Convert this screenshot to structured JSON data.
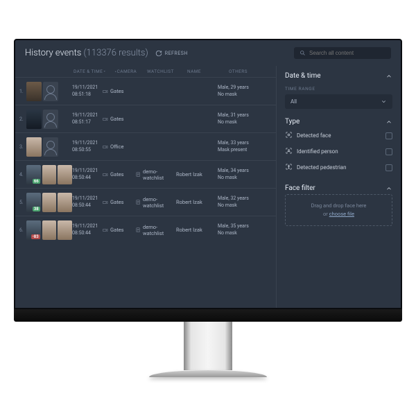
{
  "header": {
    "title": "History events",
    "result_count": "(113376 results)",
    "refresh": "REFRESH",
    "search_placeholder": "Search all content"
  },
  "columns": {
    "datetime": "DATE & TIME",
    "camera": "CAMERA",
    "watchlist": "WATCHLIST",
    "name": "NAME",
    "others": "OTHERS"
  },
  "rows": [
    {
      "idx": "1.",
      "date": "19/11/2021",
      "time": "08:51:18",
      "camera": "Gates",
      "watchlist": "",
      "name": "",
      "other1": "Male, 29 years",
      "other2": "No mask",
      "thumbs": [
        "face1",
        "placeholder"
      ],
      "score": null
    },
    {
      "idx": "2.",
      "date": "19/11/2021",
      "time": "08:51:17",
      "camera": "Gates",
      "watchlist": "",
      "name": "",
      "other1": "Male, 31 years",
      "other2": "No mask",
      "thumbs": [
        "face2",
        "placeholder"
      ],
      "score": null
    },
    {
      "idx": "3.",
      "date": "19/11/2021",
      "time": "08:50:55",
      "camera": "Office",
      "watchlist": "",
      "name": "",
      "other1": "Male, 33 years",
      "other2": "Mask present",
      "thumbs": [
        "face3",
        "placeholder"
      ],
      "score": null
    },
    {
      "idx": "4.",
      "date": "19/11/2021",
      "time": "08:50:44",
      "camera": "Gates",
      "watchlist": "demo-watchlist",
      "name": "Robert Izak",
      "other1": "Male, 34 years",
      "other2": "No mask",
      "thumbs": [
        "face4",
        "face3",
        "face3"
      ],
      "score": {
        "val": "66",
        "cls": "green"
      }
    },
    {
      "idx": "5.",
      "date": "19/11/2021",
      "time": "08:50:44",
      "camera": "Gates",
      "watchlist": "demo-watchlist",
      "name": "Robert Izak",
      "other1": "Male, 32 years",
      "other2": "No mask",
      "thumbs": [
        "face4",
        "face3",
        "face3"
      ],
      "score": {
        "val": "38",
        "cls": "green"
      }
    },
    {
      "idx": "6.",
      "date": "19/11/2021",
      "time": "08:50:44",
      "camera": "Gates",
      "watchlist": "demo-watchlist",
      "name": "Robert Izak",
      "other1": "Male, 35 years",
      "other2": "No mask",
      "thumbs": [
        "face4",
        "face3",
        "face3"
      ],
      "score": {
        "val": "-83",
        "cls": "red"
      }
    }
  ],
  "side": {
    "datetime": {
      "title": "Date & time",
      "range_label": "TIME RANGE",
      "range_value": "All"
    },
    "type": {
      "title": "Type",
      "options": [
        {
          "key": "detected-face",
          "label": "Detected face"
        },
        {
          "key": "identified-person",
          "label": "Identified person"
        },
        {
          "key": "detected-pedestrian",
          "label": "Detected pedestrian"
        }
      ]
    },
    "face_filter": {
      "title": "Face filter",
      "drop_text": "Drag and drop face here",
      "or": "or ",
      "link": "choose file"
    }
  }
}
